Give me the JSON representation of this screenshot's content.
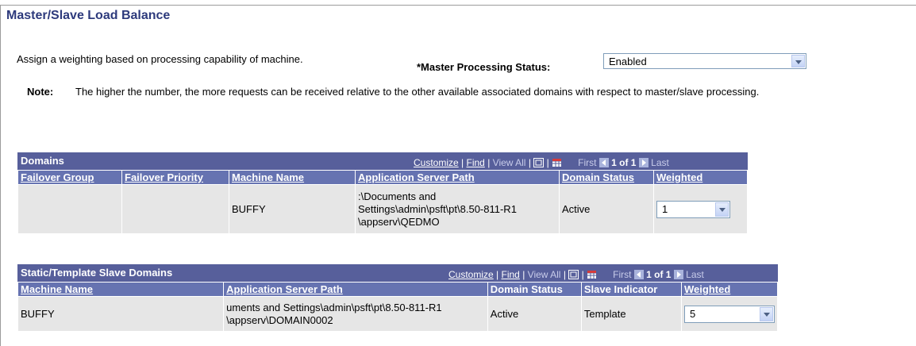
{
  "page": {
    "title": "Master/Slave Load Balance",
    "intro": "Assign a weighting based on processing capability of machine.",
    "master_status_label": "*Master Processing Status:",
    "master_status_value": "Enabled",
    "note_label": "Note:",
    "note_text": "The higher the number, the more requests can be received relative to the other available associated domains with respect to master/slave processing."
  },
  "grid_nav": {
    "customize": "Customize",
    "sep": "|",
    "find": "Find",
    "view_all": "View All",
    "first": "First",
    "range": "1 of 1",
    "last": "Last"
  },
  "domains": {
    "title": "Domains",
    "columns": [
      "Failover Group",
      "Failover Priority",
      "Machine Name",
      "Application Server Path",
      "Domain Status",
      "Weighted"
    ],
    "row": {
      "failover_group": "",
      "failover_priority": "",
      "machine_name": "BUFFY",
      "path_lines": [
        ":\\Documents and",
        "Settings\\admin\\psft\\pt\\8.50-811-R1",
        "\\appserv\\QEDMO"
      ],
      "domain_status": "Active",
      "weighted": "1"
    }
  },
  "static_domains": {
    "title": "Static/Template Slave Domains",
    "columns": [
      "Machine Name",
      "Application Server Path",
      "Domain Status",
      "Slave Indicator",
      "Weighted"
    ],
    "row": {
      "machine_name": "BUFFY",
      "path_lines": [
        "uments and Settings\\admin\\psft\\pt\\8.50-811-R1",
        "\\appserv\\DOMAIN0002"
      ],
      "domain_status": "Active",
      "slave_indicator": "Template",
      "weighted": "5"
    }
  },
  "icons": {
    "zoom": "new-window-icon",
    "download": "download-grid-icon",
    "prev": "previous-arrow-icon",
    "next": "next-arrow-icon",
    "dropdown": "chevron-down-icon"
  }
}
